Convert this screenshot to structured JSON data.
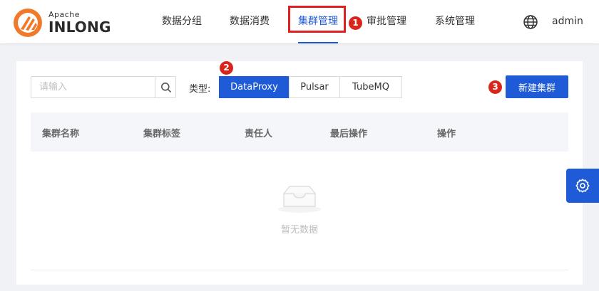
{
  "brand": {
    "small": "Apache",
    "big": "INLONG"
  },
  "nav": {
    "items": [
      {
        "label": "数据分组"
      },
      {
        "label": "数据消费"
      },
      {
        "label": "集群管理"
      },
      {
        "label": "审批管理"
      },
      {
        "label": "系统管理"
      }
    ],
    "active_index": 2
  },
  "user": {
    "name": "admin"
  },
  "search": {
    "placeholder": "请输入",
    "value": ""
  },
  "type_filter": {
    "label": "类型:",
    "options": [
      "DataProxy",
      "Pulsar",
      "TubeMQ"
    ],
    "selected": "DataProxy"
  },
  "actions": {
    "new_cluster_label": "新建集群"
  },
  "table": {
    "columns": [
      "集群名称",
      "集群标签",
      "责任人",
      "最后操作",
      "操作"
    ],
    "rows": [],
    "empty_text": "暂无数据"
  },
  "annotations": {
    "marker_1": "1",
    "marker_2": "2",
    "marker_3": "3"
  },
  "icons": {
    "search": "search-icon",
    "language": "globe-icon",
    "settings": "gear-icon",
    "empty": "empty-inbox-icon"
  },
  "colors": {
    "primary": "#1f5ad7",
    "annotation_red": "#d9261c",
    "logo_orange": "#f07a2a"
  }
}
